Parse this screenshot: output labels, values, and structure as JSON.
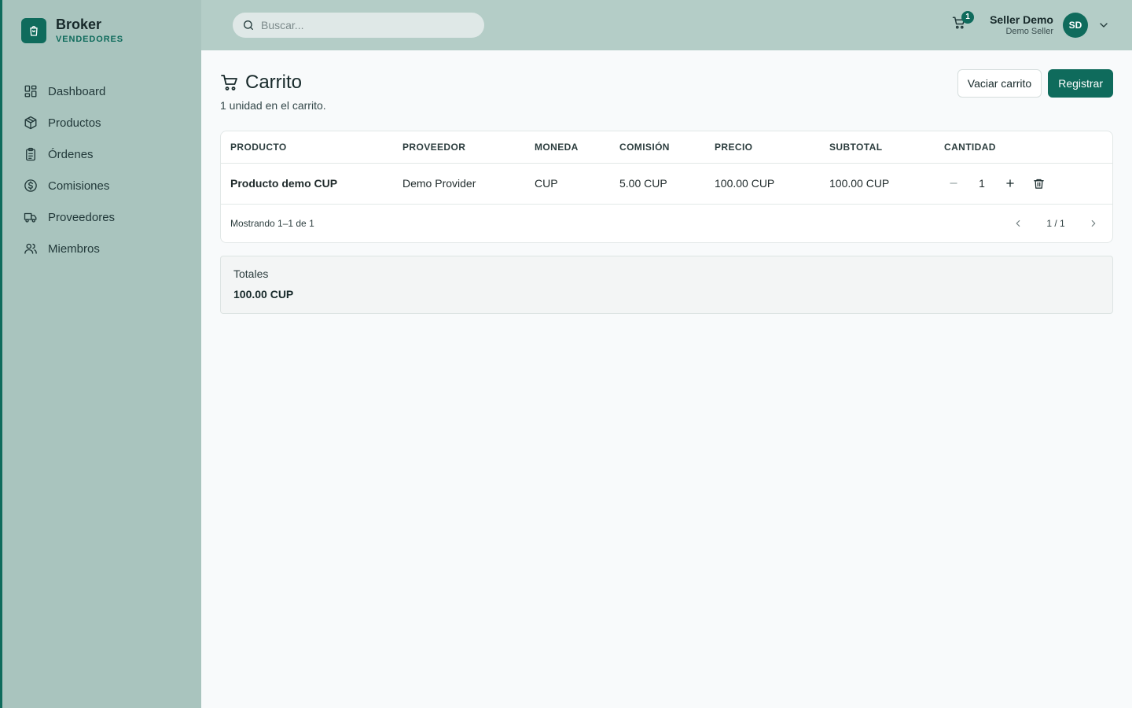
{
  "brand": {
    "name": "Broker",
    "subtitle": "VENDEDORES"
  },
  "sidebar": {
    "items": [
      {
        "label": "Dashboard",
        "icon": "dashboard-icon"
      },
      {
        "label": "Productos",
        "icon": "box-icon"
      },
      {
        "label": "Órdenes",
        "icon": "clipboard-icon"
      },
      {
        "label": "Comisiones",
        "icon": "dollar-circle-icon"
      },
      {
        "label": "Proveedores",
        "icon": "truck-icon"
      },
      {
        "label": "Miembros",
        "icon": "users-icon"
      }
    ]
  },
  "topbar": {
    "search_placeholder": "Buscar...",
    "cart_count": "1",
    "user_name": "Seller Demo",
    "user_role": "Demo Seller",
    "avatar_initials": "SD"
  },
  "page": {
    "title": "Carrito",
    "subtitle": "1 unidad en el carrito.",
    "clear_label": "Vaciar carrito",
    "register_label": "Registrar"
  },
  "table": {
    "headers": [
      "PRODUCTO",
      "PROVEEDOR",
      "MONEDA",
      "COMISIÓN",
      "PRECIO",
      "SUBTOTAL",
      "CANTIDAD"
    ],
    "rows": [
      {
        "product": "Producto demo CUP",
        "provider": "Demo Provider",
        "currency": "CUP",
        "commission": "5.00 CUP",
        "price": "100.00 CUP",
        "subtotal": "100.00 CUP",
        "quantity": "1"
      }
    ],
    "footer_text": "Mostrando 1–1 de 1",
    "page_info": "1 / 1"
  },
  "totals": {
    "label": "Totales",
    "value": "100.00 CUP"
  },
  "colors": {
    "accent": "#0f6b5c",
    "sidebar": "#a9c4be",
    "topbar": "#b4cdc7"
  }
}
